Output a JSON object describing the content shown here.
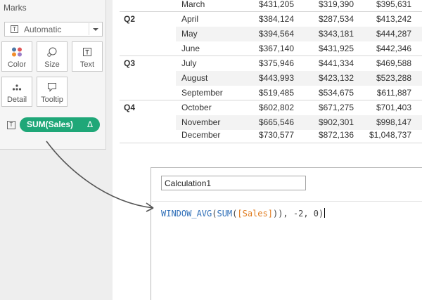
{
  "marks": {
    "title": "Marks",
    "mark_type": "Automatic",
    "mark_type_icon": "text-mark-icon",
    "buttons": [
      {
        "label": "Color",
        "icon": "color-dots-icon"
      },
      {
        "label": "Size",
        "icon": "size-icon"
      },
      {
        "label": "Text",
        "icon": "text-icon"
      },
      {
        "label": "Detail",
        "icon": "detail-dots-icon"
      },
      {
        "label": "Tooltip",
        "icon": "tooltip-icon"
      }
    ],
    "pill": {
      "label": "SUM(Sales)",
      "delta": "Δ",
      "color": "#1fa778"
    }
  },
  "table": {
    "quarters": [
      "Q2",
      "Q3",
      "Q4"
    ],
    "rows": [
      {
        "month": "March",
        "values": [
          "$431,205",
          "$319,390",
          "$395,631"
        ]
      },
      {
        "month": "April",
        "values": [
          "$384,124",
          "$287,534",
          "$413,242"
        ]
      },
      {
        "month": "May",
        "values": [
          "$394,564",
          "$343,181",
          "$444,287"
        ]
      },
      {
        "month": "June",
        "values": [
          "$367,140",
          "$431,925",
          "$442,346"
        ]
      },
      {
        "month": "July",
        "values": [
          "$375,946",
          "$441,334",
          "$469,588"
        ]
      },
      {
        "month": "August",
        "values": [
          "$443,993",
          "$423,132",
          "$523,288"
        ]
      },
      {
        "month": "September",
        "values": [
          "$519,485",
          "$534,675",
          "$611,887"
        ]
      },
      {
        "month": "October",
        "values": [
          "$602,802",
          "$671,275",
          "$701,403"
        ]
      },
      {
        "month": "November",
        "values": [
          "$665,546",
          "$902,301",
          "$998,147"
        ]
      },
      {
        "month": "December",
        "values": [
          "$730,577",
          "$872,136",
          "$1,048,737"
        ]
      }
    ]
  },
  "calc": {
    "name": "Calculation1",
    "formula": {
      "fn_outer": "WINDOW_AVG",
      "p1": "(",
      "fn_inner": "SUM",
      "p2": "(",
      "field": "[Sales]",
      "rest": ")), -2, 0)"
    },
    "colors": {
      "function": "#2f6fb8",
      "field": "#e07a1c"
    }
  }
}
